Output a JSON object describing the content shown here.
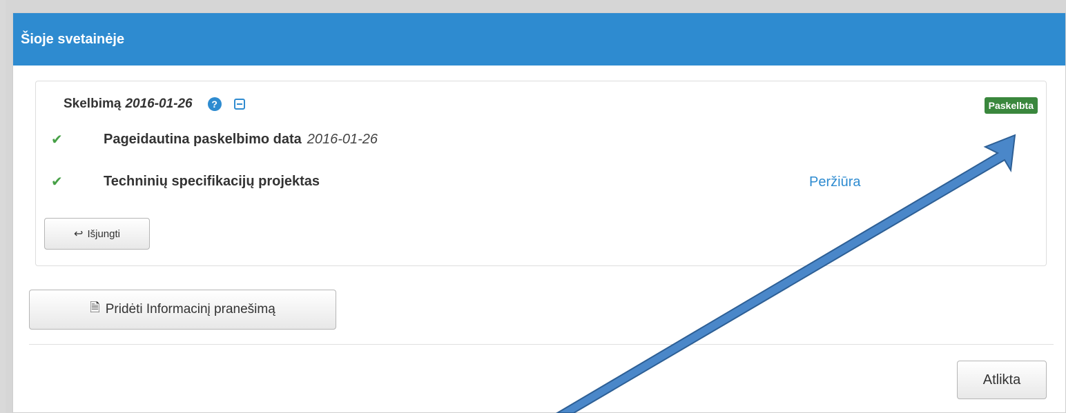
{
  "panel": {
    "title": "Šioje svetainėje"
  },
  "notice": {
    "title_prefix": "Skelbimą",
    "title_date": "2016-01-26",
    "help_symbol": "?",
    "status": "Paskelbta",
    "status_color": "#3a873d",
    "rows": [
      {
        "label": "Pageidautina paskelbimo data",
        "value": "2016-01-26"
      },
      {
        "label": "Techninių specifikacijų projektas",
        "link": "Peržiūra"
      }
    ],
    "disable_button": "Išjungti"
  },
  "actions": {
    "add_button": "Pridėti Informacinį pranešimą",
    "done_button": "Atlikta"
  },
  "icons": {
    "check": "✔",
    "reply": "↩",
    "document": "🗎"
  },
  "colors": {
    "header": "#2e8bd0",
    "link": "#2e8bd0",
    "check": "#46a046"
  }
}
